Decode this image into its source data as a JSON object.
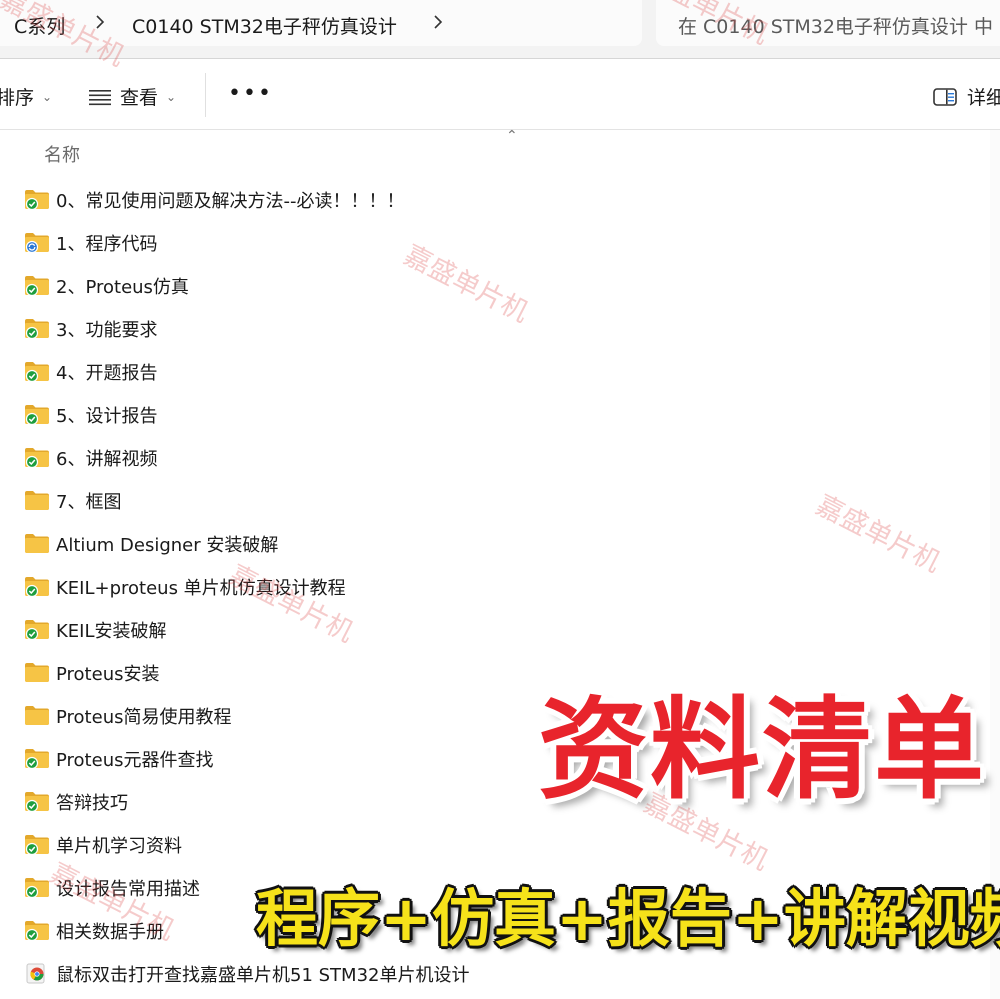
{
  "address_bar": {
    "breadcrumb": [
      "C系列",
      "C0140 STM32电子秤仿真设计"
    ],
    "search_placeholder": "在 C0140 STM32电子秤仿真设计 中"
  },
  "command_bar": {
    "sort_label": "排序",
    "view_label": "查看",
    "more_label": "•••",
    "details_label": "详细"
  },
  "list": {
    "column_name": "名称",
    "items": [
      {
        "name": "0、常见使用问题及解决方法--必读！！！！",
        "icon": "folder-sync-icon"
      },
      {
        "name": "1、程序代码",
        "icon": "folder-syncing-icon"
      },
      {
        "name": "2、Proteus仿真",
        "icon": "folder-sync-icon"
      },
      {
        "name": "3、功能要求",
        "icon": "folder-sync-icon"
      },
      {
        "name": "4、开题报告",
        "icon": "folder-sync-icon"
      },
      {
        "name": "5、设计报告",
        "icon": "folder-sync-icon"
      },
      {
        "name": "6、讲解视频",
        "icon": "folder-sync-icon"
      },
      {
        "name": "7、框图",
        "icon": "folder-icon"
      },
      {
        "name": "Altium Designer 安装破解",
        "icon": "folder-icon"
      },
      {
        "name": "KEIL+proteus 单片机仿真设计教程",
        "icon": "folder-sync-icon"
      },
      {
        "name": "KEIL安装破解",
        "icon": "folder-sync-icon"
      },
      {
        "name": "Proteus安装",
        "icon": "folder-icon"
      },
      {
        "name": "Proteus简易使用教程",
        "icon": "folder-icon"
      },
      {
        "name": "Proteus元器件查找",
        "icon": "folder-sync-icon"
      },
      {
        "name": "答辩技巧",
        "icon": "folder-sync-icon"
      },
      {
        "name": "单片机学习资料",
        "icon": "folder-sync-icon"
      },
      {
        "name": "设计报告常用描述",
        "icon": "folder-sync-icon"
      },
      {
        "name": "相关数据手册",
        "icon": "folder-sync-icon"
      },
      {
        "name": "鼠标双击打开查找嘉盛单片机51 STM32单片机设计",
        "icon": "browser-link-icon"
      }
    ]
  },
  "watermark_text": "嘉盛单片机",
  "banner": {
    "title": "资料清单",
    "subtitle": "程序+仿真+报告+讲解视频"
  },
  "colors": {
    "folder": "#f6c445",
    "folder_dark": "#e3a82b",
    "sync_green": "#1e9e3e",
    "sync_blue": "#2a78d6",
    "banner_red": "#e8242c",
    "banner_yellow": "#f6e21a"
  }
}
